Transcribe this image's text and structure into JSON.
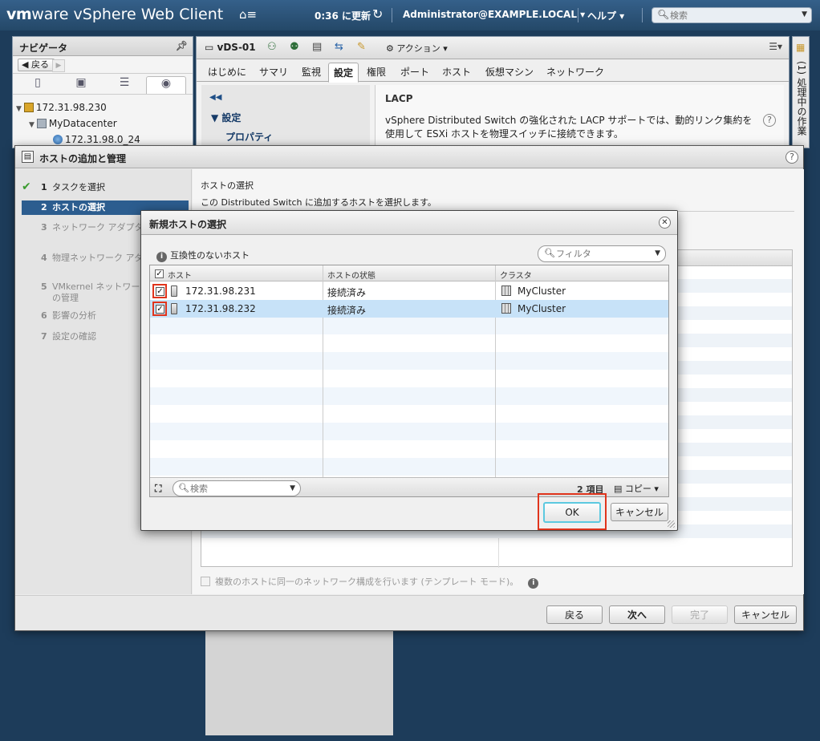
{
  "header": {
    "brand_vm": "vm",
    "brand_ware": "ware",
    "brand_product": " vSphere Web Client",
    "update_time": "0:36 に更新",
    "user": "Administrator@EXAMPLE.LOCAL ▾",
    "help": "ヘルプ ▾",
    "search_placeholder": "検索"
  },
  "navigator": {
    "title": "ナビゲータ",
    "back_label": "戻る",
    "tree": [
      "172.31.98.230",
      "MyDatacenter",
      "172.31.98.0_24"
    ]
  },
  "object": {
    "name": "vDS-01",
    "actions_label": "アクション ▾",
    "tabs": [
      "はじめに",
      "サマリ",
      "監視",
      "設定",
      "権限",
      "ポート",
      "ホスト",
      "仮想マシン",
      "ネットワーク"
    ],
    "active_tab": "設定",
    "config_section": "設定",
    "config_sub": "プロパティ",
    "lacp_title": "LACP",
    "lacp_desc": "vSphere Distributed Switch の強化された LACP サポートでは、動的リンク集約を使用して ESXi ホストを物理スイッチに接続できます。"
  },
  "right_panel": {
    "vertical_label": "(1) 処理中の作業"
  },
  "wizard": {
    "title": "ホストの追加と管理",
    "steps": [
      {
        "num": "1",
        "label": "タスクを選択"
      },
      {
        "num": "2",
        "label": "ホストの選択"
      },
      {
        "num": "3",
        "label": "ネットワーク アダプタの選択"
      },
      {
        "num": "4",
        "label": "物理ネットワーク アダプタの管理"
      },
      {
        "num": "5",
        "label": "VMkernel ネットワーク アダプタの管理"
      },
      {
        "num": "6",
        "label": "影響の分析"
      },
      {
        "num": "7",
        "label": "設定の確認"
      }
    ],
    "content_heading": "ホストの選択",
    "content_sub": "この Distributed Switch に追加するホストを選択します。",
    "template_mode": "複数のホストに同一のネットワーク構成を行います (テンプレート モード)。",
    "buttons": {
      "back": "戻る",
      "next": "次へ",
      "finish": "完了",
      "cancel": "キャンセル"
    }
  },
  "modal": {
    "title": "新規ホストの選択",
    "incompatible_label": "互換性のないホスト",
    "filter_placeholder": "フィルタ",
    "columns": [
      "ホスト",
      "ホストの状態",
      "クラスタ"
    ],
    "rows": [
      {
        "host": "172.31.98.231",
        "state": "接続済み",
        "cluster": "MyCluster"
      },
      {
        "host": "172.31.98.232",
        "state": "接続済み",
        "cluster": "MyCluster"
      }
    ],
    "search_placeholder": "検索",
    "item_count": "2 項目",
    "copy_label": "コピー ▾",
    "ok_label": "OK",
    "cancel_label": "キャンセル"
  }
}
